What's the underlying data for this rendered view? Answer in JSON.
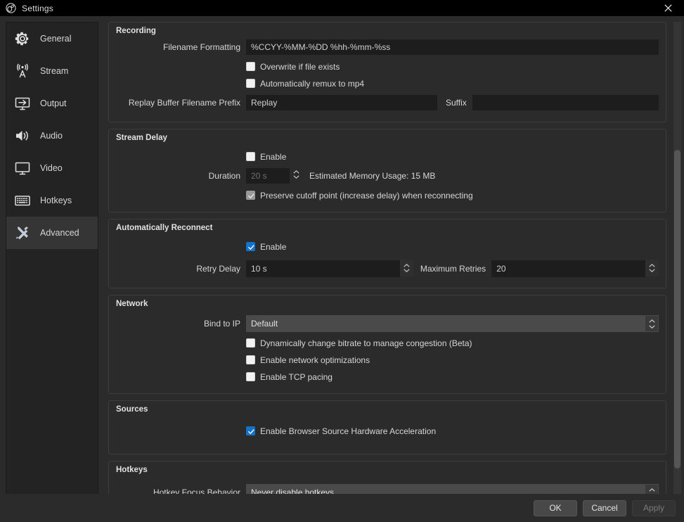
{
  "window": {
    "title": "Settings",
    "logo_icon": "obs-logo-icon",
    "close_icon": "close-icon"
  },
  "sidebar": {
    "items": [
      {
        "label": "General",
        "icon": "gear-icon",
        "selected": false
      },
      {
        "label": "Stream",
        "icon": "broadcast-icon",
        "selected": false
      },
      {
        "label": "Output",
        "icon": "output-icon",
        "selected": false
      },
      {
        "label": "Audio",
        "icon": "speaker-icon",
        "selected": false
      },
      {
        "label": "Video",
        "icon": "monitor-icon",
        "selected": false
      },
      {
        "label": "Hotkeys",
        "icon": "keyboard-icon",
        "selected": false
      },
      {
        "label": "Advanced",
        "icon": "tools-icon",
        "selected": true
      }
    ]
  },
  "groups": {
    "recording": {
      "title": "Recording",
      "filename_formatting_label": "Filename Formatting",
      "filename_formatting_value": "%CCYY-%MM-%DD %hh-%mm-%ss",
      "overwrite_label": "Overwrite if file exists",
      "overwrite_checked": false,
      "remux_label": "Automatically remux to mp4",
      "remux_checked": false,
      "replay_prefix_label": "Replay Buffer Filename Prefix",
      "replay_prefix_value": "Replay",
      "suffix_label": "Suffix",
      "suffix_value": ""
    },
    "stream_delay": {
      "title": "Stream Delay",
      "enable_label": "Enable",
      "enable_checked": false,
      "duration_label": "Duration",
      "duration_value": "20 s",
      "memory_usage_text": "Estimated Memory Usage: 15 MB",
      "preserve_label": "Preserve cutoff point (increase delay) when reconnecting",
      "preserve_checked": true,
      "preserve_disabled": true
    },
    "auto_reconnect": {
      "title": "Automatically Reconnect",
      "enable_label": "Enable",
      "enable_checked": true,
      "retry_delay_label": "Retry Delay",
      "retry_delay_value": "10 s",
      "max_retries_label": "Maximum Retries",
      "max_retries_value": "20"
    },
    "network": {
      "title": "Network",
      "bind_ip_label": "Bind to IP",
      "bind_ip_value": "Default",
      "dynamic_bitrate_label": "Dynamically change bitrate to manage congestion (Beta)",
      "dynamic_bitrate_checked": false,
      "net_opt_label": "Enable network optimizations",
      "net_opt_checked": false,
      "tcp_pacing_label": "Enable TCP pacing",
      "tcp_pacing_checked": false
    },
    "sources": {
      "title": "Sources",
      "browser_hw_label": "Enable Browser Source Hardware Acceleration",
      "browser_hw_checked": true
    },
    "hotkeys": {
      "title": "Hotkeys",
      "focus_behavior_label": "Hotkey Focus Behavior",
      "focus_behavior_value": "Never disable hotkeys"
    }
  },
  "footer": {
    "ok_label": "OK",
    "cancel_label": "Cancel",
    "apply_label": "Apply",
    "apply_disabled": true
  },
  "colors": {
    "accent": "#1273c8",
    "window_bg": "#2b2b2b",
    "sidebar_bg": "#232323",
    "input_bg": "#1d1d1d",
    "combo_bg": "#4a4a4a"
  }
}
